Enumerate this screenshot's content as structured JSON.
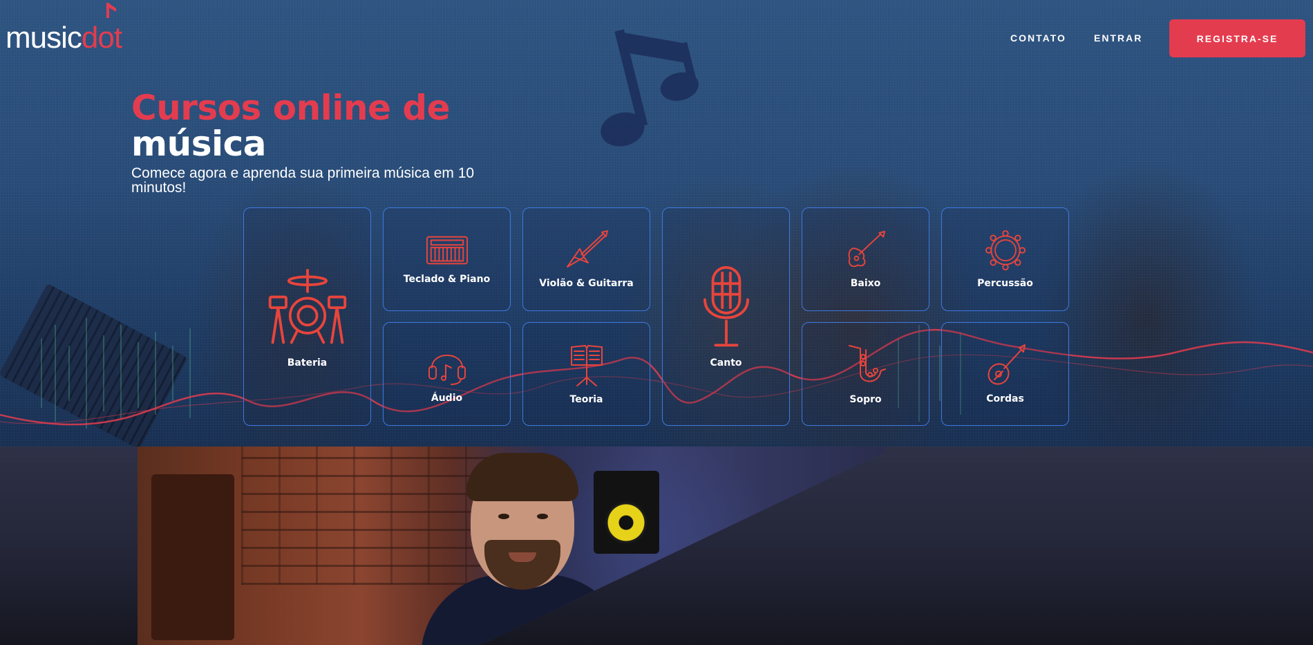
{
  "brand": {
    "logo_part1": "music",
    "logo_part2": "dot"
  },
  "nav": {
    "contact": "CONTATO",
    "login": "ENTRAR",
    "register": "REGISTRA-SE"
  },
  "hero": {
    "title_line1": "Cursos online de",
    "title_line2": "música",
    "subtitle": "Comece agora e aprenda sua primeira música em 10 minutos!"
  },
  "categories": [
    {
      "label": "Bateria",
      "icon": "drum-kit-icon"
    },
    {
      "label": "Teclado & Piano",
      "icon": "keyboard-icon"
    },
    {
      "label": "Violão & Guitarra",
      "icon": "electric-guitar-icon"
    },
    {
      "label": "Canto",
      "icon": "microphone-icon"
    },
    {
      "label": "Baixo",
      "icon": "bass-guitar-icon"
    },
    {
      "label": "Percussão",
      "icon": "tambourine-icon"
    },
    {
      "label": "Áudio",
      "icon": "headphones-icon"
    },
    {
      "label": "Teoria",
      "icon": "music-stand-icon"
    },
    {
      "label": "Sopro",
      "icon": "saxophone-icon"
    },
    {
      "label": "Cordas",
      "icon": "mandolin-icon"
    }
  ],
  "colors": {
    "accent": "#e43c4f",
    "card_border": "#3f7ae0",
    "hero_bg": "#2a4e7a",
    "section_bg": "#2b2e42"
  }
}
